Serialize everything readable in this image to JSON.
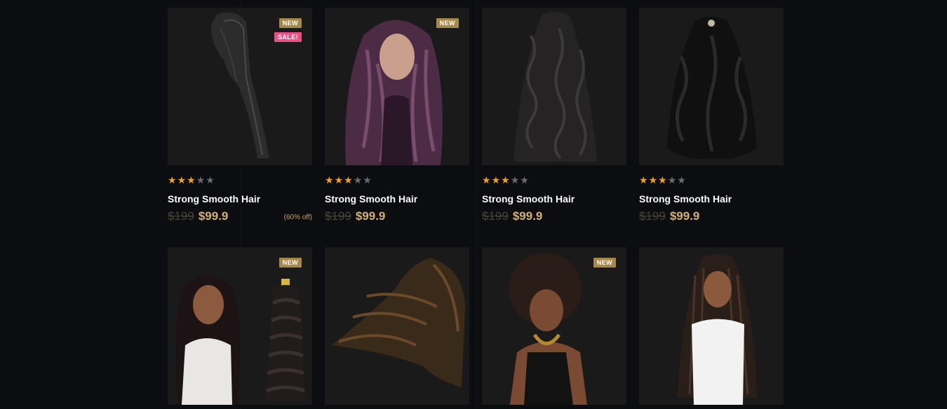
{
  "products": [
    {
      "badges": [
        "NEW",
        "SALE!"
      ],
      "rating": 3,
      "max_rating": 5,
      "title": "Strong Smooth Hair",
      "old_price": "$199",
      "price": "$99.9",
      "discount": "(60% off)",
      "image": "straight black hair piece"
    },
    {
      "badges": [
        "NEW"
      ],
      "rating": 3,
      "max_rating": 5,
      "title": "Strong Smooth Hair",
      "old_price": "$199",
      "price": "$99.9",
      "discount": "",
      "image": "woman with long purple curly hair"
    },
    {
      "badges": [],
      "rating": 3,
      "max_rating": 5,
      "title": "Strong Smooth Hair",
      "old_price": "$199",
      "price": "$99.9",
      "discount": "",
      "image": "deep wave hair bundle"
    },
    {
      "badges": [],
      "rating": 3,
      "max_rating": 5,
      "title": "Strong Smooth Hair",
      "old_price": "$199",
      "price": "$99.9",
      "discount": "",
      "image": "long black curly wig"
    },
    {
      "badges": [
        "NEW"
      ],
      "rating": null,
      "title": "",
      "old_price": "",
      "price": "",
      "discount": "",
      "image": "woman with curly hair and hair bundle"
    },
    {
      "badges": [],
      "rating": null,
      "title": "",
      "old_price": "",
      "price": "",
      "discount": "",
      "image": "flowing brown hair"
    },
    {
      "badges": [
        "NEW"
      ],
      "rating": null,
      "title": "",
      "old_price": "",
      "price": "",
      "discount": "",
      "image": "woman with afro"
    },
    {
      "badges": [],
      "rating": null,
      "title": "",
      "old_price": "",
      "price": "",
      "discount": "",
      "image": "woman with braided hair"
    }
  ],
  "colors": {
    "background": "#0c0d10",
    "card": "#1a1a1a",
    "accent": "#d5b070",
    "new_badge": "#a6884a",
    "sale_badge": "#ec4f87",
    "star": "#f3a11b"
  }
}
